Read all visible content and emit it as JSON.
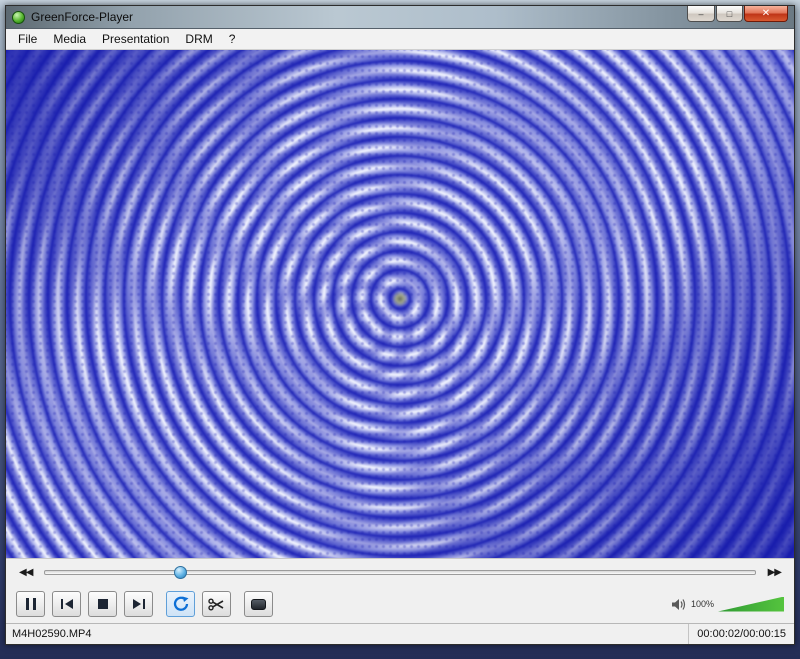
{
  "window": {
    "title": "GreenForce-Player",
    "controls": {
      "minimize": "–",
      "maximize": "□",
      "close": "✕"
    }
  },
  "menu": {
    "items": [
      "File",
      "Media",
      "Presentation",
      "DRM",
      "?"
    ]
  },
  "transport": {
    "rewind_icon": "◀◀",
    "forward_icon": "▶▶",
    "seek_position_percent": 19,
    "volume_percent": "100%"
  },
  "icons": {
    "app": "green-sphere",
    "pause": "two-bars",
    "step_back": "bar-left-triangle",
    "stop": "square",
    "step_forward": "triangle-bar-right",
    "loop": "blue-circular-arrow",
    "cut": "scissors",
    "capture": "dark-slab",
    "speaker": "speaker-with-waves"
  },
  "status": {
    "filename": "M4H02590.MP4",
    "time": "00:00:02/00:00:15"
  }
}
